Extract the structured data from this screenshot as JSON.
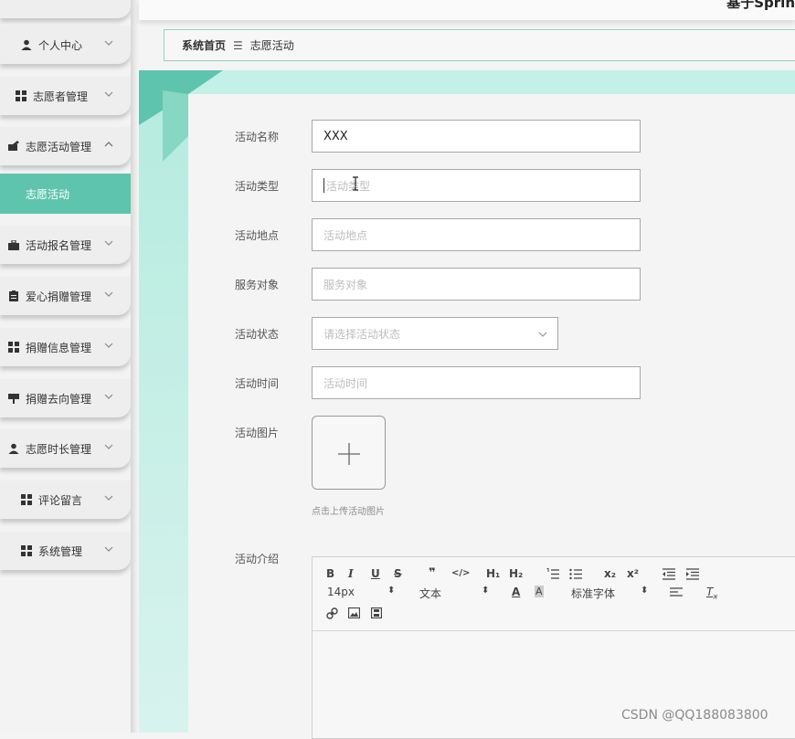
{
  "topbar": {
    "title_fragment": "基于Sprin"
  },
  "sidebar": {
    "items": [
      {
        "label": "个人中心",
        "icon": "person-icon"
      },
      {
        "label": "志愿者管理",
        "icon": "grid-icon"
      },
      {
        "label": "志愿活动管理",
        "icon": "activity-icon"
      },
      {
        "label": "活动报名管理",
        "icon": "briefcase-icon"
      },
      {
        "label": "爱心捐赠管理",
        "icon": "clipboard-icon"
      },
      {
        "label": "捐赠信息管理",
        "icon": "grid-icon"
      },
      {
        "label": "捐赠去向管理",
        "icon": "signpost-icon"
      },
      {
        "label": "志愿时长管理",
        "icon": "person-icon"
      },
      {
        "label": "评论留言",
        "icon": "grid-icon"
      },
      {
        "label": "系统管理",
        "icon": "grid-icon"
      }
    ],
    "active_sub": "志愿活动"
  },
  "breadcrumb": {
    "home": "系统首页",
    "sep": "☰",
    "current": "志愿活动"
  },
  "form": {
    "name": {
      "label": "活动名称",
      "value": "XXX"
    },
    "type": {
      "label": "活动类型",
      "placeholder": "活动类型"
    },
    "place": {
      "label": "活动地点",
      "placeholder": "活动地点"
    },
    "target": {
      "label": "服务对象",
      "placeholder": "服务对象"
    },
    "status": {
      "label": "活动状态",
      "placeholder": "请选择活动状态"
    },
    "time": {
      "label": "活动时间",
      "placeholder": "活动时间"
    },
    "image": {
      "label": "活动图片",
      "hint": "点击上传活动图片"
    },
    "intro": {
      "label": "活动介绍"
    }
  },
  "editor": {
    "bold": "B",
    "italic": "I",
    "underline": "U",
    "strike": "S",
    "quote": "❞",
    "code": "</>",
    "h1": "H₁",
    "h2": "H₂",
    "sub": "x₂",
    "sup": "x²",
    "font_size": "14px",
    "text_style": "文本",
    "font_family": "标准字体"
  },
  "watermark": "CSDN @QQ188083800",
  "colors": {
    "accent": "#5fc4ad",
    "teal_light": "#c3f0e7"
  }
}
